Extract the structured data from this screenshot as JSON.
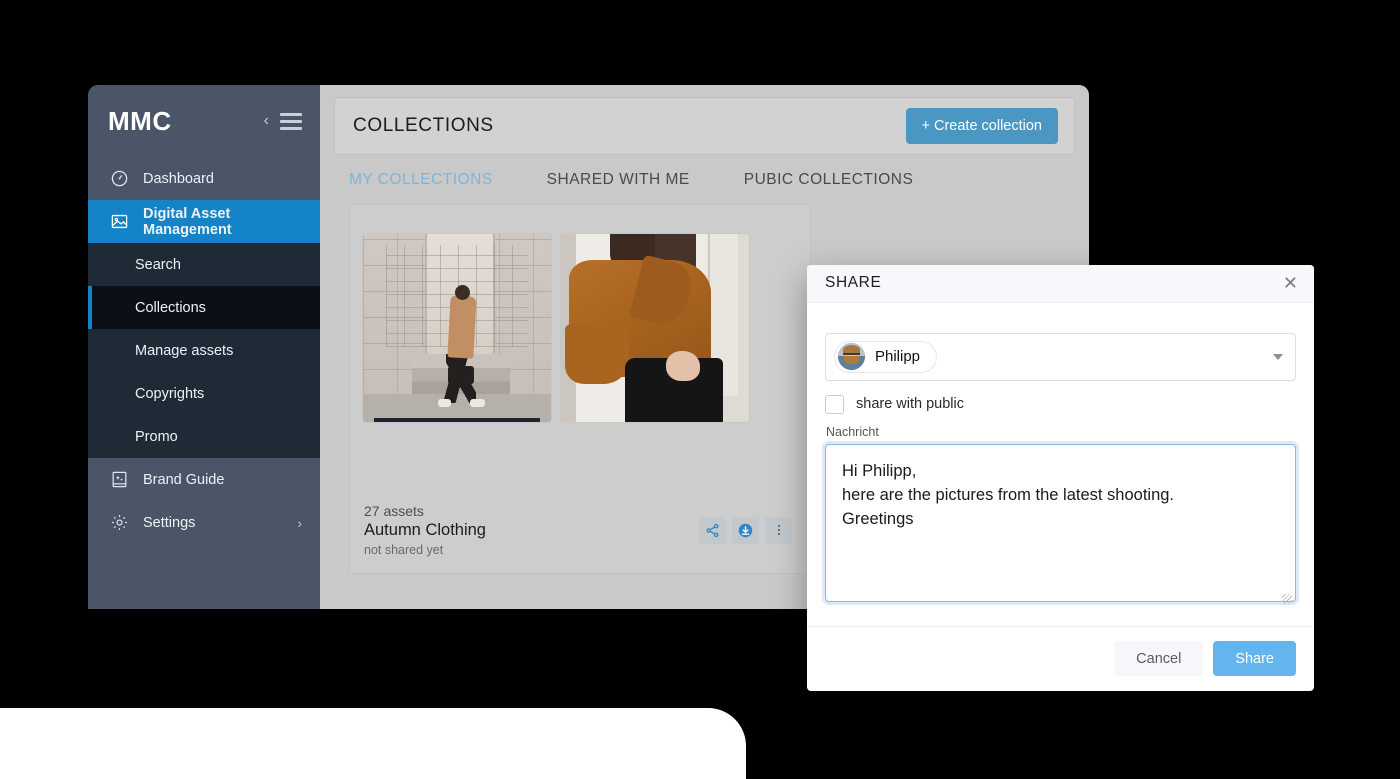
{
  "brand": {
    "logo_text": "MMC"
  },
  "sidebar": {
    "collapse_icon": "chevron-left-icon",
    "menu_icon": "hamburger-menu-icon",
    "items": [
      {
        "label": "Dashboard",
        "icon": "gauge-icon"
      },
      {
        "label": "Digital Asset Management",
        "icon": "image-icon"
      }
    ],
    "sub_items": [
      {
        "label": "Search"
      },
      {
        "label": "Collections"
      },
      {
        "label": "Manage assets"
      },
      {
        "label": "Copyrights"
      },
      {
        "label": "Promo"
      }
    ],
    "bottom_items": [
      {
        "label": "Brand Guide",
        "icon": "book-sparkle-icon"
      },
      {
        "label": "Settings",
        "icon": "gear-icon",
        "chevron": "›"
      }
    ]
  },
  "main": {
    "page_title": "COLLECTIONS",
    "create_button": "+ Create collection",
    "tabs": [
      {
        "label": "MY COLLECTIONS",
        "active": true
      },
      {
        "label": "SHARED WITH ME",
        "active": false
      },
      {
        "label": "PUBIC COLLECTIONS",
        "active": false
      }
    ],
    "collection": {
      "assets_count": "27 assets",
      "title": "Autumn Clothing",
      "share_status": "not shared yet",
      "actions": [
        {
          "name": "share-icon"
        },
        {
          "name": "download-icon"
        },
        {
          "name": "more-options-icon"
        }
      ]
    }
  },
  "modal": {
    "title": "SHARE",
    "close_icon": "close-icon",
    "recipient": {
      "name": "Philipp",
      "avatar": "user-avatar"
    },
    "checkbox": {
      "label": "share with public",
      "checked": false
    },
    "message": {
      "label": "Nachricht",
      "value": "Hi Philipp,\nhere are the pictures from the latest shooting.\nGreetings"
    },
    "cancel_label": "Cancel",
    "share_label": "Share"
  },
  "colors": {
    "accent_blue": "#1483c8",
    "button_blue": "#4b97c4",
    "share_blue": "#64b5ee",
    "sidebar": "#4a5568",
    "sidebar_sub": "#1f2a37",
    "tab_active": "#7fb4d8"
  }
}
